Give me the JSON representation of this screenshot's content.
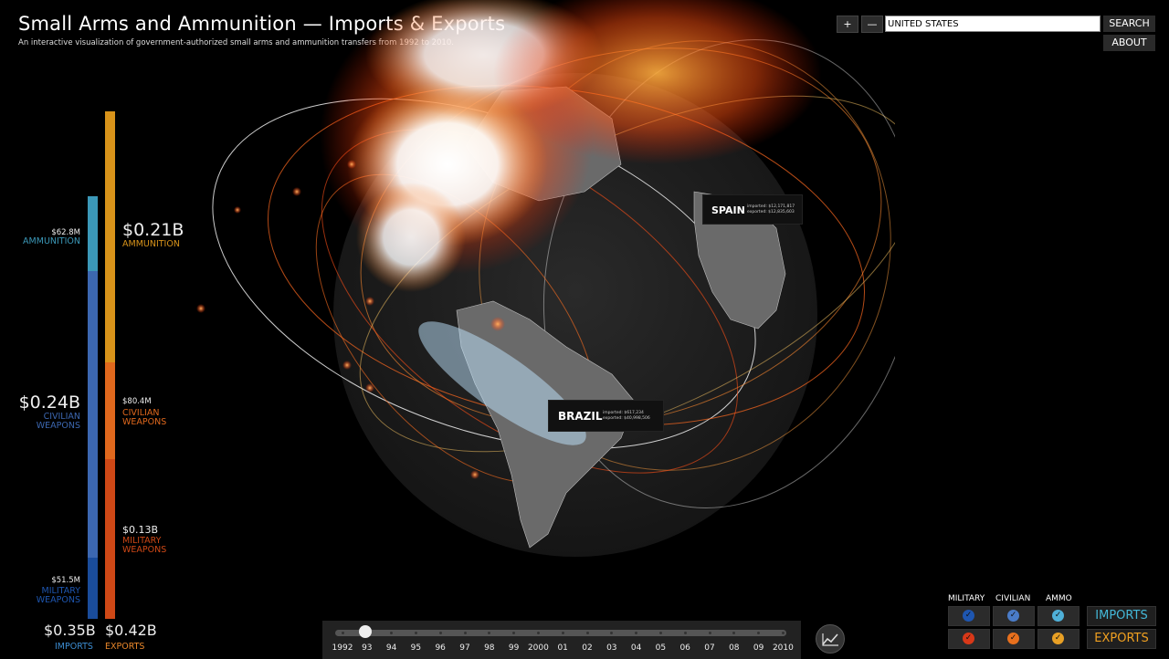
{
  "header": {
    "title": "Small Arms and Ammunition — Imports & Exports",
    "subtitle": "An interactive visualization of government-authorized small arms and ammunition transfers from 1992 to 2010."
  },
  "controls": {
    "zoom_in": "+",
    "zoom_out": "—",
    "search_value": "UNITED STATES",
    "search_label": "SEARCH",
    "about_label": "ABOUT"
  },
  "imports": {
    "total": "$0.35B",
    "label": "IMPORTS",
    "ammunition": {
      "value": "$62.8M",
      "label_1": "AMMUNITION"
    },
    "civilian": {
      "value": "$0.24B",
      "label_1": "CIVILIAN",
      "label_2": "WEAPONS"
    },
    "military": {
      "value": "$51.5M",
      "label_1": "MILITARY",
      "label_2": "WEAPONS"
    }
  },
  "exports": {
    "total": "$0.42B",
    "label": "EXPORTS",
    "ammunition": {
      "value": "$0.21B",
      "label_1": "AMMUNITION"
    },
    "civilian": {
      "value": "$80.4M",
      "label_1": "CIVILIAN",
      "label_2": "WEAPONS"
    },
    "military": {
      "value": "$0.13B",
      "label_1": "MILITARY",
      "label_2": "WEAPONS"
    }
  },
  "tooltips": {
    "spain": {
      "name": "SPAIN",
      "imported": "imported: $12,171,817",
      "exported": "exported: $12,835,603"
    },
    "brazil": {
      "name": "BRAZIL",
      "imported": "imported: $617,234",
      "exported": "exported: $40,998,506"
    }
  },
  "timeline": {
    "years": [
      "1992",
      "93",
      "94",
      "95",
      "96",
      "97",
      "98",
      "99",
      "2000",
      "01",
      "02",
      "03",
      "04",
      "05",
      "06",
      "07",
      "08",
      "09",
      "2010"
    ],
    "selected": "93"
  },
  "filters": {
    "columns": [
      "MILITARY",
      "CIVILIAN",
      "AMMO"
    ],
    "imports_label": "IMPORTS",
    "exports_label": "EXPORTS",
    "check_mark": "✓"
  },
  "colors": {
    "military_import": "#1a4c9a",
    "civilian_import": "#3c67b0",
    "ammo_import": "#3b98b8",
    "military_export": "#cf4816",
    "civilian_export": "#e0681d",
    "ammo_export": "#d8931a",
    "imports_text": "#44b8d8",
    "exports_text": "#f0a020"
  }
}
